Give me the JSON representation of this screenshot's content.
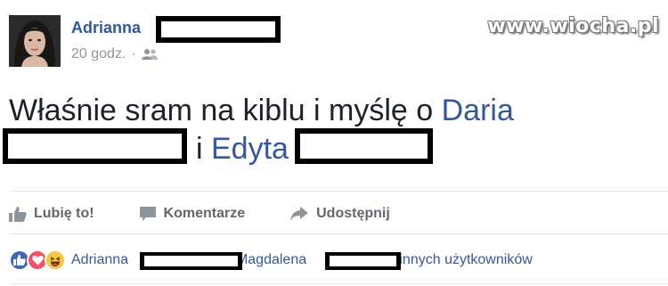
{
  "post": {
    "author": "Adrianna",
    "time": "20 godz.",
    "separator": "·",
    "privacy_icon": "friends-icon",
    "text_line1_prefix": "Właśnie sram na kiblu i myślę o ",
    "text_mention1": "Daria",
    "text_line2_mid": "i ",
    "text_mention2": "Edyta"
  },
  "watermark": "www.wiocha.pl",
  "actions": [
    {
      "label": "Lubię to!",
      "icon": "thumbs-up-icon"
    },
    {
      "label": "Komentarze",
      "icon": "comment-icon"
    },
    {
      "label": "Udostępnij",
      "icon": "share-icon"
    }
  ],
  "reactions": {
    "icons": [
      "like-reaction-icon",
      "love-reaction-icon",
      "haha-reaction-icon"
    ],
    "name1": "Adrianna",
    "comma": ",",
    "name2": "Magdalena",
    "others": "13 innych użytkowników"
  },
  "colors": {
    "link": "#365899",
    "text": "#1d2129",
    "muted": "#90949c",
    "action": "#606770",
    "divider": "#e5e5e5",
    "like": "#4267b2",
    "love": "#f25268",
    "haha": "#f7c744"
  }
}
